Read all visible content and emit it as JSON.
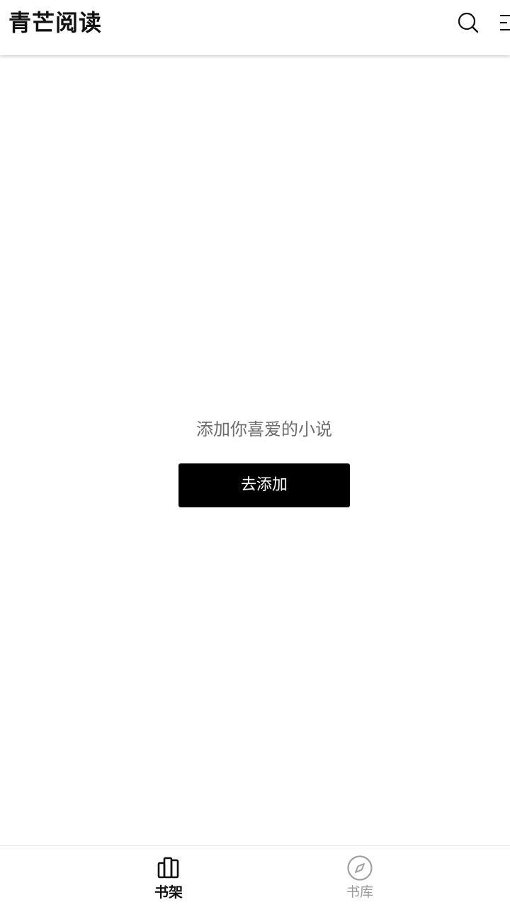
{
  "header": {
    "title": "青芒阅读",
    "search_icon": "search-icon",
    "menu_icon": "list-menu-icon"
  },
  "empty_state": {
    "message": "添加你喜爱的小说",
    "button_label": "去添加"
  },
  "tabbar": {
    "tabs": [
      {
        "label": "书架",
        "icon": "bookshelf-icon",
        "active": true
      },
      {
        "label": "书库",
        "icon": "compass-icon",
        "active": false
      }
    ]
  },
  "colors": {
    "background": "#ffffff",
    "primary_text": "#111111",
    "secondary_text": "#6b6b6b",
    "button_bg": "#000000",
    "button_text": "#ffffff",
    "inactive_tab": "#9a9a9a"
  }
}
